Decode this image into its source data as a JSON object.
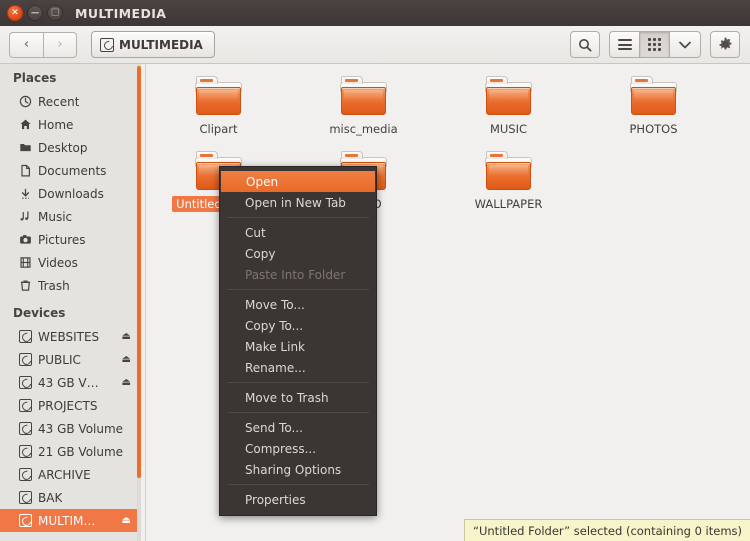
{
  "window": {
    "title": "MULTIMEDIA",
    "buttons": {
      "close": "×",
      "minimize": "−",
      "maximize": "□"
    }
  },
  "toolbar": {
    "back_label": "‹",
    "forward_label": "›",
    "breadcrumb": "MULTIMEDIA",
    "search_label": "⌕",
    "list_view_label": "list-view",
    "icon_view_label": "icon-view",
    "view_dropdown_label": "⌄",
    "settings_label": "gear"
  },
  "sidebar": {
    "places_header": "Places",
    "places": [
      {
        "label": "Recent",
        "icon": "◴"
      },
      {
        "label": "Home",
        "icon": "⌂"
      },
      {
        "label": "Desktop",
        "icon": "▰"
      },
      {
        "label": "Documents",
        "icon": "❐"
      },
      {
        "label": "Downloads",
        "icon": "⤵"
      },
      {
        "label": "Music",
        "icon": "♫"
      },
      {
        "label": "Pictures",
        "icon": "▣"
      },
      {
        "label": "Videos",
        "icon": "☷"
      },
      {
        "label": "Trash",
        "icon": "⌧"
      }
    ],
    "devices_header": "Devices",
    "devices": [
      {
        "label": "WEBSITES",
        "eject": true,
        "selected": false
      },
      {
        "label": "PUBLIC",
        "eject": true,
        "selected": false
      },
      {
        "label": "43 GB V…",
        "eject": true,
        "selected": false
      },
      {
        "label": "PROJECTS",
        "eject": false,
        "selected": false
      },
      {
        "label": "43 GB Volume",
        "eject": false,
        "selected": false
      },
      {
        "label": "21 GB Volume",
        "eject": false,
        "selected": false
      },
      {
        "label": "ARCHIVE",
        "eject": false,
        "selected": false
      },
      {
        "label": "BAK",
        "eject": false,
        "selected": false
      },
      {
        "label": "MULTIM…",
        "eject": true,
        "selected": true
      }
    ],
    "eject_glyph": "⏏"
  },
  "main": {
    "rows": [
      [
        {
          "label": "Clipart",
          "selected": false
        },
        {
          "label": "misc_media",
          "selected": false
        },
        {
          "label": "MUSIC",
          "selected": false
        },
        {
          "label": "PHOTOS",
          "selected": false
        }
      ],
      [
        {
          "label": "Untitled Folder",
          "selected": true
        },
        {
          "label": "VIDEO",
          "selected": false
        },
        {
          "label": "WALLPAPER",
          "selected": false
        }
      ]
    ]
  },
  "statusbar": {
    "text": "“Untitled Folder” selected  (containing 0 items)"
  },
  "context_menu": {
    "items": [
      {
        "label": "Open",
        "type": "item",
        "highlight": true
      },
      {
        "label": "Open in New Tab",
        "type": "item"
      },
      {
        "type": "separator"
      },
      {
        "label": "Cut",
        "type": "item"
      },
      {
        "label": "Copy",
        "type": "item"
      },
      {
        "label": "Paste Into Folder",
        "type": "item",
        "disabled": true
      },
      {
        "type": "separator"
      },
      {
        "label": "Move To...",
        "type": "item"
      },
      {
        "label": "Copy To...",
        "type": "item"
      },
      {
        "label": "Make Link",
        "type": "item"
      },
      {
        "label": "Rename...",
        "type": "item"
      },
      {
        "type": "separator"
      },
      {
        "label": "Move to Trash",
        "type": "item"
      },
      {
        "type": "separator"
      },
      {
        "label": "Send To...",
        "type": "item"
      },
      {
        "label": "Compress...",
        "type": "item"
      },
      {
        "label": "Sharing Options",
        "type": "item"
      },
      {
        "type": "separator"
      },
      {
        "label": "Properties",
        "type": "item"
      }
    ]
  },
  "colors": {
    "accent": "#f07746",
    "titlebar": "#3c3634",
    "menu_bg": "#3b3633",
    "status_bg": "#f6f4c8",
    "sidebar_bg": "#e5e3e0",
    "main_bg": "#f1f0ee"
  }
}
